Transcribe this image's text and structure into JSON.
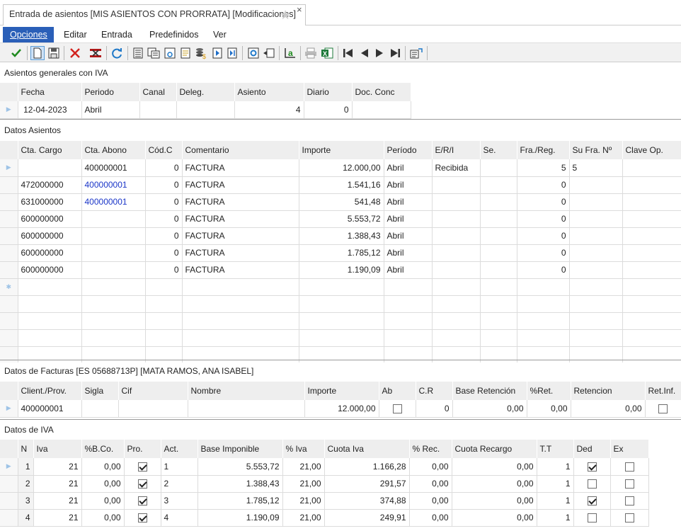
{
  "tab": {
    "title": "Entrada de asientos [MIS ASIENTOS CON PRORRATA] [Modificaciones]",
    "star": "★",
    "close": "×"
  },
  "menu": [
    {
      "label": "Opciones",
      "active": true
    },
    {
      "label": "Editar"
    },
    {
      "label": "Entrada"
    },
    {
      "label": "Predefinidos"
    },
    {
      "label": "Ver"
    }
  ],
  "toolbar_icons": [
    "check-icon",
    "new-document-icon",
    "save-icon",
    "delete-icon",
    "cancel-entry-icon",
    "refresh-icon",
    "list-icon",
    "copy-list-icon",
    "preview-icon",
    "document-icon",
    "stack-money-icon",
    "next-page-icon",
    "last-page-icon",
    "settings-icon",
    "window-icon",
    "text-format-icon",
    "print-icon",
    "excel-icon",
    "first-record-icon",
    "previous-record-icon",
    "next-record-icon",
    "last-record-icon",
    "export-icon"
  ],
  "general": {
    "title": "Asientos generales con IVA",
    "headers": [
      "Fecha",
      "Periodo",
      "Canal",
      "Deleg.",
      "Asiento",
      "Diario",
      "Doc. Conc"
    ],
    "row": {
      "fecha": "12-04-2023",
      "periodo": "Abril",
      "canal": "",
      "deleg": "",
      "asiento": "4",
      "diario": "0",
      "doc": ""
    }
  },
  "datos_asientos": {
    "title": "Datos Asientos",
    "headers": [
      "Cta. Cargo",
      "Cta. Abono",
      "Cód.C",
      "Comentario",
      "Importe",
      "Período",
      "E/R/I",
      "Se.",
      "Fra./Reg.",
      "Su Fra. Nº",
      "Clave Op."
    ],
    "rows": [
      {
        "cargo": "",
        "abono": "400000001",
        "cod": "0",
        "comentario": "FACTURA",
        "importe": "12.000,00",
        "periodo": "Abril",
        "eri": "Recibida",
        "se": "",
        "fra": "5",
        "sufra": "5",
        "clave": ""
      },
      {
        "cargo": "472000000",
        "abono": "400000001",
        "cod": "0",
        "comentario": "FACTURA",
        "importe": "1.541,16",
        "periodo": "Abril",
        "eri": "",
        "se": "",
        "fra": "0",
        "sufra": "",
        "clave": ""
      },
      {
        "cargo": "631000000",
        "abono": "400000001",
        "cod": "0",
        "comentario": "FACTURA",
        "importe": "541,48",
        "periodo": "Abril",
        "eri": "",
        "se": "",
        "fra": "0",
        "sufra": "",
        "clave": ""
      },
      {
        "cargo": "600000000",
        "abono": "",
        "cod": "0",
        "comentario": "FACTURA",
        "importe": "5.553,72",
        "periodo": "Abril",
        "eri": "",
        "se": "",
        "fra": "0",
        "sufra": "",
        "clave": ""
      },
      {
        "cargo": "600000000",
        "abono": "",
        "cod": "0",
        "comentario": "FACTURA",
        "importe": "1.388,43",
        "periodo": "Abril",
        "eri": "",
        "se": "",
        "fra": "0",
        "sufra": "",
        "clave": ""
      },
      {
        "cargo": "600000000",
        "abono": "",
        "cod": "0",
        "comentario": "FACTURA",
        "importe": "1.785,12",
        "periodo": "Abril",
        "eri": "",
        "se": "",
        "fra": "0",
        "sufra": "",
        "clave": ""
      },
      {
        "cargo": "600000000",
        "abono": "",
        "cod": "0",
        "comentario": "FACTURA",
        "importe": "1.190,09",
        "periodo": "Abril",
        "eri": "",
        "se": "",
        "fra": "0",
        "sufra": "",
        "clave": ""
      }
    ]
  },
  "facturas": {
    "title": "Datos de Facturas [ES 05688713P] [MATA RAMOS, ANA ISABEL]",
    "headers": [
      "Client./Prov.",
      "Sigla",
      "Cif",
      "Nombre",
      "Importe",
      "Ab",
      "C.R",
      "Base Retención",
      "%Ret.",
      "Retencion",
      "Ret.Inf."
    ],
    "row": {
      "cliente": "400000001",
      "sigla": "",
      "cif": "",
      "nombre": "",
      "importe": "12.000,00",
      "ab": false,
      "cr": "0",
      "base": "0,00",
      "ret": "0,00",
      "retencion": "0,00",
      "retinf": false
    }
  },
  "iva": {
    "title": "Datos de IVA",
    "headers": [
      "N",
      "Iva",
      "%B.Co.",
      "Pro.",
      "Act.",
      "Base Imponible",
      "% Iva",
      "Cuota Iva",
      "% Rec.",
      "Cuota Recargo",
      "T.T",
      "Ded",
      "Ex"
    ],
    "rows": [
      {
        "n": "1",
        "iva": "21",
        "bco": "0,00",
        "pro": true,
        "act": "1",
        "base": "5.553,72",
        "piva": "21,00",
        "cuota": "1.166,28",
        "rec": "0,00",
        "cuotarec": "0,00",
        "tt": "1",
        "ded": true,
        "ex": false
      },
      {
        "n": "2",
        "iva": "21",
        "bco": "0,00",
        "pro": true,
        "act": "2",
        "base": "1.388,43",
        "piva": "21,00",
        "cuota": "291,57",
        "rec": "0,00",
        "cuotarec": "0,00",
        "tt": "1",
        "ded": false,
        "ex": false
      },
      {
        "n": "3",
        "iva": "21",
        "bco": "0,00",
        "pro": true,
        "act": "3",
        "base": "1.785,12",
        "piva": "21,00",
        "cuota": "374,88",
        "rec": "0,00",
        "cuotarec": "0,00",
        "tt": "1",
        "ded": true,
        "ex": false
      },
      {
        "n": "4",
        "iva": "21",
        "bco": "0,00",
        "pro": true,
        "act": "4",
        "base": "1.190,09",
        "piva": "21,00",
        "cuota": "249,91",
        "rec": "0,00",
        "cuotarec": "0,00",
        "tt": "1",
        "ded": false,
        "ex": false
      }
    ]
  }
}
